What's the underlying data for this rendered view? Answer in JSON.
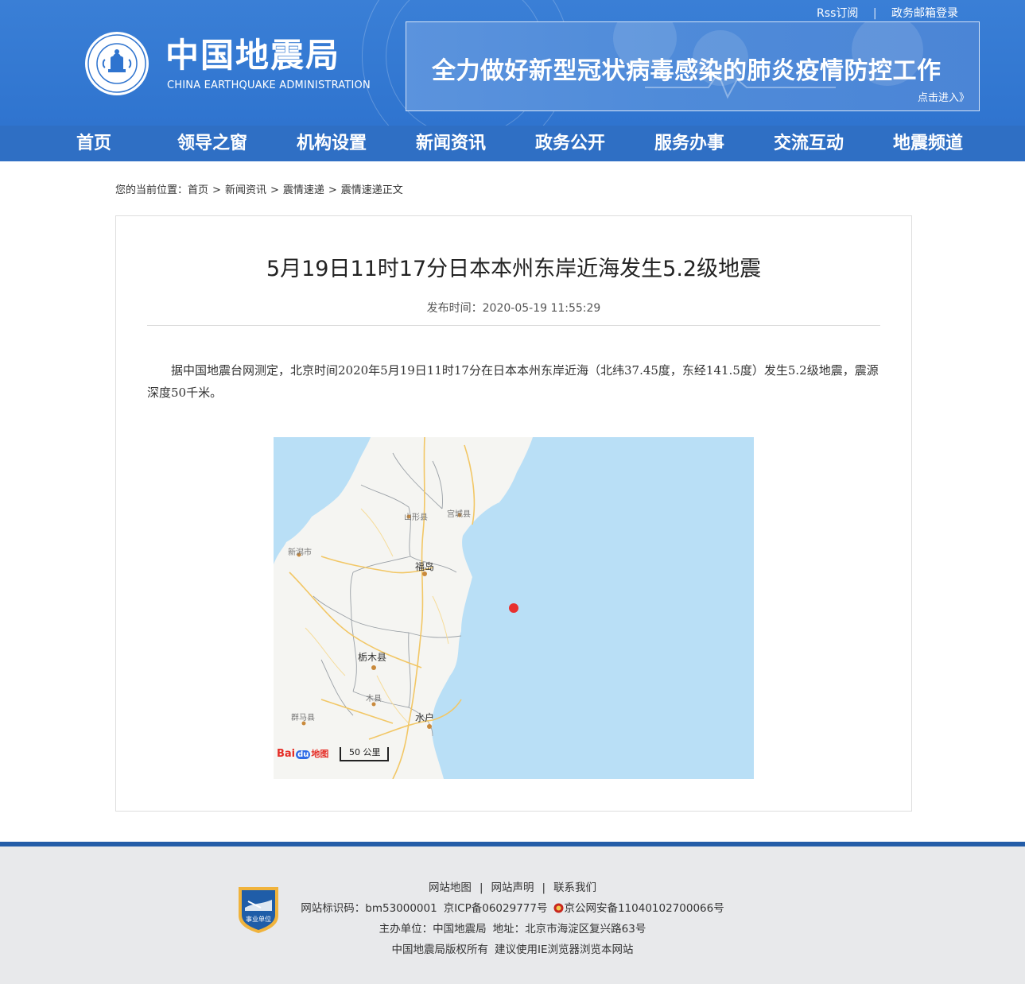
{
  "header": {
    "top_links": [
      "Rss订阅",
      "政务邮箱登录"
    ],
    "separator": "|",
    "logo_cn": "中国地震局",
    "logo_en": "CHINA EARTHQUAKE ADMINISTRATION",
    "emblem_text_top": "CHINA EARTHQUAKE ADMINISTRATION",
    "emblem_text_bottom": "中国地震局",
    "banner_title": "全力做好新型冠状病毒感染的肺炎疫情防控工作",
    "banner_link": "点击进入》"
  },
  "nav": [
    "首页",
    "领导之窗",
    "机构设置",
    "新闻资讯",
    "政务公开",
    "服务办事",
    "交流互动",
    "地震频道"
  ],
  "breadcrumb": {
    "prefix": "您的当前位置：",
    "items": [
      "首页",
      "新闻资讯",
      "震情速递",
      "震情速递正文"
    ],
    "arrow": ">"
  },
  "article": {
    "title": "5月19日11时17分日本本州东岸近海发生5.2级地震",
    "date_label": "发布时间：",
    "date_value": "2020-05-19 11:55:29",
    "body": "据中国地震台网测定，北京时间2020年5月19日11时17分在日本本州东岸近海（北纬37.45度，东经141.5度）发生5.2级地震，震源深度50千米。"
  },
  "map": {
    "labels": [
      "山形县",
      "宫城县",
      "新潟市",
      "福岛",
      "栃木县",
      "木县",
      "群马县",
      "水户"
    ],
    "scale": "50 公里",
    "brand_bai": "Bai",
    "brand_du": "du",
    "brand_map": "地图",
    "epicenter_color": "#e8312f",
    "sea_color": "#b9dff6",
    "land_color": "#f5f5f2"
  },
  "footer": {
    "links": [
      "网站地图",
      "网站声明",
      "联系我们"
    ],
    "separator": "|",
    "row2_id": "网站标识码：bm53000001",
    "row2_icp": "京ICP备06029777号",
    "row2_police": "京公网安备11040102700066号",
    "row3_sponsor": "主办单位：中国地震局",
    "row3_address": "地址：北京市海淀区复兴路63号",
    "row4_copyright": "中国地震局版权所有",
    "row4_browser": "建议使用IE浏览器浏览本网站",
    "badge_text": "事业单位"
  }
}
